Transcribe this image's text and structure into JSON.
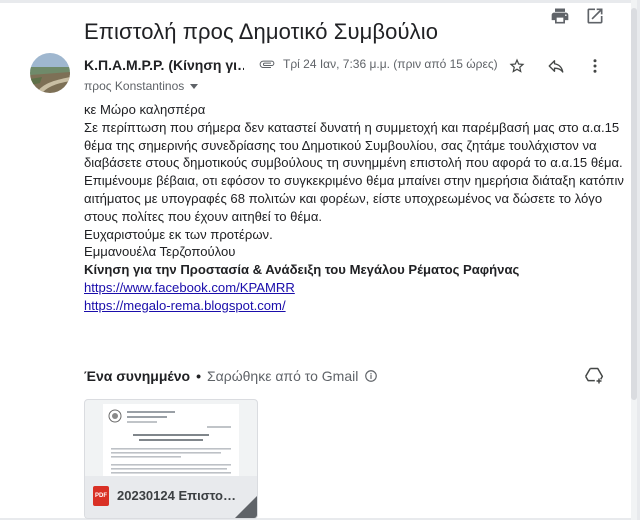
{
  "subject": "Επιστολή προς Δημοτικό Συμβούλιο",
  "message": {
    "sender": "Κ.Π.Α.Μ.Ρ.Ρ. (Κίνηση γι…",
    "datetime": "Τρί 24 Ιαν, 7:36 μ.μ. (πριν από 15 ώρες)",
    "to": "προς Konstantinos",
    "body": [
      "κε Μώρο καλησπέρα",
      "Σε περίπτωση που σήμερα δεν καταστεί δυνατή η συμμετοχή και παρέμβασή μας στο α.α.15",
      "θέμα της σημερινής συνεδρίασης του Δημοτικού Συμβουλίου, σας ζητάμε τουλάχιστον να",
      "διαβάσετε στους δημοτικούς συμβούλους τη συνημμένη επιστολή που αφορά το α.α.15 θέμα.",
      "Επιμένουμε βέβαια, οτι εφόσον το συγκεκριμένο θέμα μπαίνει στην ημερήσια διάταξη κατόπιν",
      "αιτήματος με υπογραφές 68 πολιτών και φορέων, είστε υποχρεωμένος να δώσετε το λόγο",
      "στους πολίτες που έχουν αιτηθεί το θέμα.",
      "Ευχαριστούμε εκ των προτέρων.",
      "Εμμανουέλα Τερζοπούλου"
    ],
    "signature": "Κίνηση για την Προστασία & Ανάδειξη του Μεγάλου Ρέματος Ραφήνας",
    "links": [
      "https://www.facebook.com/KPAMRR",
      "https://megalo-rema.blogspot.com/"
    ]
  },
  "attachments": {
    "title": "Ένα συνημμένο",
    "separator": "•",
    "scan_note": "Σαρώθηκε από το Gmail",
    "file_name": "20230124 Επιστο…",
    "file_type": "PDF"
  },
  "icons": {
    "print": "print-icon",
    "open_new_window": "open-in-new-icon",
    "attachment": "paperclip-icon",
    "star": "star-icon",
    "reply": "reply-icon",
    "more": "more-vert-icon",
    "info": "info-icon",
    "add_to_drive": "add-to-drive-icon"
  },
  "colors": {
    "link": "#1a0dab",
    "muted": "#5f6368",
    "pdf": "#d93025"
  }
}
